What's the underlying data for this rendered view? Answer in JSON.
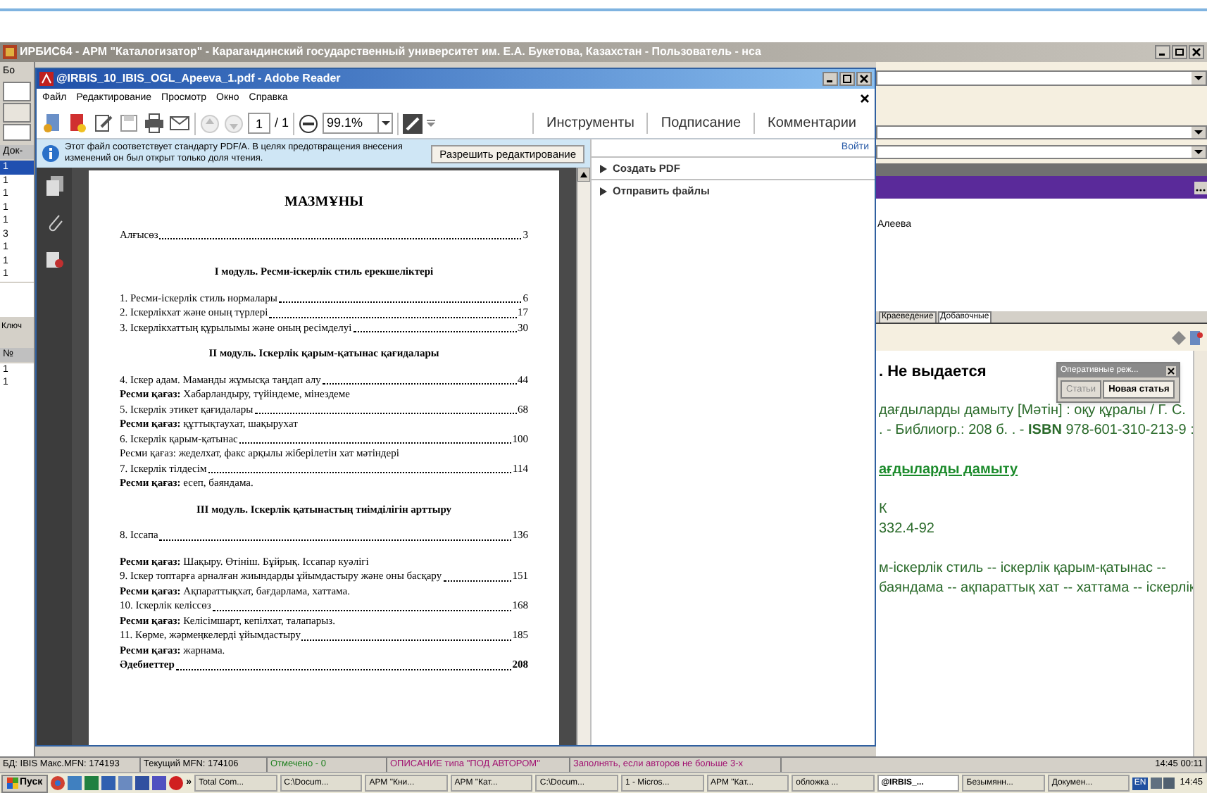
{
  "irbis": {
    "title": "ИРБИС64 - АРМ \"Каталогизатор\" - Карагандинский государственный университет им. Е.А. Букетова, Казахстан - Пользователь - нса",
    "left_labels": [
      "Бо",
      "Док-"
    ],
    "left_rows": [
      {
        "text": "1",
        "selected": true
      },
      {
        "text": "1",
        "selected": false
      },
      {
        "text": "1",
        "selected": false
      },
      {
        "text": "1",
        "selected": false
      },
      {
        "text": "1",
        "selected": false
      },
      {
        "text": "3",
        "selected": false
      },
      {
        "text": "1",
        "selected": false
      },
      {
        "text": "1",
        "selected": false
      },
      {
        "text": "1",
        "selected": false
      }
    ],
    "key_label": "Ключ",
    "num_label": "№",
    "num_rows": [
      "1",
      "1"
    ],
    "author_cell": "Алеева",
    "tabs": [
      {
        "label": "Краеведение",
        "selected": false
      },
      {
        "label": "Добавочные",
        "selected": true
      }
    ],
    "record": [
      {
        "kind": "title",
        "text": ". Не выдается"
      },
      {
        "kind": "gap"
      },
      {
        "kind": "line",
        "text": "дағдыларды дамыту [Мәтін] : оқу құралы / Г. С."
      },
      {
        "kind": "line",
        "text": ". - Библиогр.: 208 б. . - **ISBN** 978-601-310-213-9 :"
      },
      {
        "kind": "gap"
      },
      {
        "kind": "link",
        "text": "ағдыларды дамыту"
      },
      {
        "kind": "gap"
      },
      {
        "kind": "line",
        "text": "К"
      },
      {
        "kind": "line",
        "text": "332.4-92"
      },
      {
        "kind": "gap"
      },
      {
        "kind": "line",
        "text": "м-іскерлік стиль -- іскерлік қарым-қатынас --"
      },
      {
        "kind": "line",
        "text": "баяндама -- ақпараттық хат -- хаттама -- іскерлік"
      }
    ],
    "popup": {
      "title": "Оперативные реж...",
      "buttons": [
        "Статьи",
        "Новая статья"
      ]
    },
    "status": [
      "БД: IBIS Макс.MFN: 174193",
      "Текущий MFN: 174106",
      "Отмечено - 0",
      "ОПИСАНИЕ типа \"ПОД АВТОРОМ\"",
      "Заполнять, если авторов не больше 3-х",
      "14:45 00:11"
    ]
  },
  "reader": {
    "title": "@IRBIS_10_IBIS_OGL_Apeeva_1.pdf - Adobe Reader",
    "menu": [
      "Файл",
      "Редактирование",
      "Просмотр",
      "Окно",
      "Справка"
    ],
    "page": "1",
    "page_total": "/ 1",
    "zoom": "99.1%",
    "tabs": [
      "Инструменты",
      "Подписание",
      "Комментарии"
    ],
    "sign_in": "Войти",
    "notice": "Этот файл соответствует стандарту PDF/A. В целях предотвращения внесения изменений он был открыт только доля чтения.",
    "notice_button": "Разрешить редактирование",
    "panels": [
      "Создать PDF",
      "Отправить файлы"
    ],
    "doc": [
      {
        "kind": "title",
        "text": "МАЗМҰНЫ"
      },
      {
        "kind": "entry",
        "text": "Алғысөз",
        "page": "3"
      },
      {
        "kind": "module",
        "text": "І модуль. Ресми-іскерлік стиль ерекшеліктері"
      },
      {
        "kind": "entry",
        "text": "1.   Ресми-іскерлік стиль нормалары",
        "page": "6"
      },
      {
        "kind": "entry",
        "text": "2.   Іскерлікхат және оның түрлері",
        "page": "17"
      },
      {
        "kind": "entry",
        "text": "3.   Іскерлікхаттың құрылымы және оның ресімделуі",
        "page": "30"
      },
      {
        "kind": "module",
        "text": "ІІ модуль. Іскерлік қарым-қатынас қағидалары"
      },
      {
        "kind": "entry",
        "text": "4.  Іскер адам. Маманды жұмысқа таңдап алу",
        "page": "44"
      },
      {
        "kind": "note",
        "text": "**Ресми қағаз:** Хабарландыру, түйіндеме, мінездеме"
      },
      {
        "kind": "entry",
        "text": "5.  Іскерлік этикет қағидалары",
        "page": "68"
      },
      {
        "kind": "note",
        "text": "**Ресми қағаз:** құттықтаухат, шақырухат"
      },
      {
        "kind": "entry",
        "text": "6.  Іскерлік қарым-қатынас",
        "page": "100"
      },
      {
        "kind": "note",
        "text": "Ресми қағаз: жеделхат, факс арқылы жіберілетін хат мәтіндері"
      },
      {
        "kind": "entry",
        "text": "7.  Іскерлік тілдесім",
        "page": "114"
      },
      {
        "kind": "note",
        "text": "**Ресми қағаз:** есеп, баяндама."
      },
      {
        "kind": "module",
        "text": "ІІІ модуль. Іскерлік қатынастың тиімділігін арттыру"
      },
      {
        "kind": "entry",
        "text": "8.   Іссапа",
        "page": "136"
      },
      {
        "kind": "note",
        "text": "**Ресми қағаз:** Шақыру. Өтініш. Бұйрық. Іссапар куәлігі"
      },
      {
        "kind": "entry",
        "text": "9.   Іскер топтарға арналған жиындарды ұйымдастыру және оны басқару",
        "page": "151"
      },
      {
        "kind": "note",
        "text": "**Ресми қағаз:** Ақпараттықхат, бағдарлама, хаттама."
      },
      {
        "kind": "entry",
        "text": "10. Іскерлік келіссөз",
        "page": "168"
      },
      {
        "kind": "note",
        "text": "**Ресми қағаз:** Келісімшарт, кепілхат, талапарыз."
      },
      {
        "kind": "entry",
        "text": "11. Көрме, жәрмеңкелерді ұйымдастыру",
        "page": "185"
      },
      {
        "kind": "note",
        "text": "**Ресми қағаз:** жарнама."
      },
      {
        "kind": "refs",
        "text": "Әдебиеттер",
        "page": "208"
      }
    ]
  },
  "taskbar": {
    "start": "Пуск",
    "more": "»",
    "tasks": [
      {
        "label": "Total Com...",
        "selected": false
      },
      {
        "label": "C:\\Docum...",
        "selected": false
      },
      {
        "label": "АРМ \"Кни...",
        "selected": false
      },
      {
        "label": "АРМ \"Кат...",
        "selected": false
      },
      {
        "label": "C:\\Docum...",
        "selected": false
      },
      {
        "label": "1 - Micros...",
        "selected": false
      },
      {
        "label": "АРМ \"Кат...",
        "selected": false
      },
      {
        "label": "обложка ...",
        "selected": false
      },
      {
        "label": "@IRBIS_...",
        "selected": true
      },
      {
        "label": "Безымянн...",
        "selected": false
      },
      {
        "label": "Докумен...",
        "selected": false
      }
    ],
    "lang": "EN",
    "clock": "14:45"
  }
}
